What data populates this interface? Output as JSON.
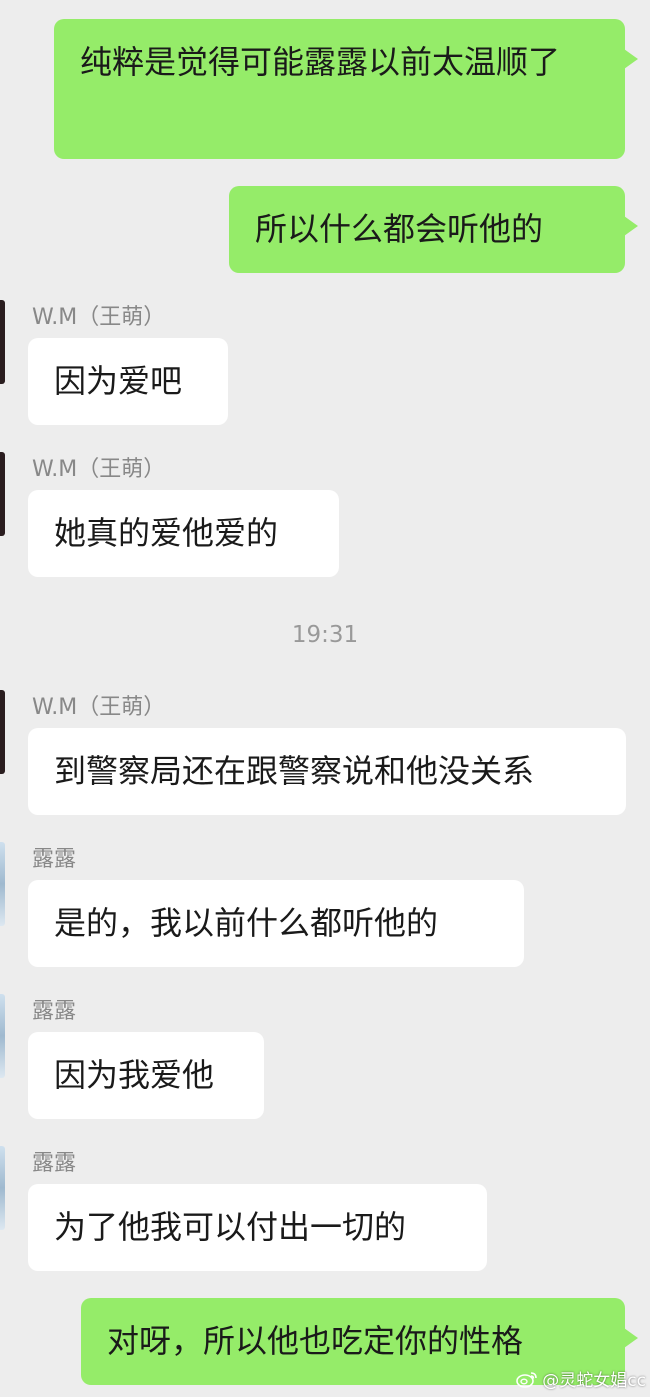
{
  "messages": [
    {
      "sender": "",
      "text": "纯粹是觉得可能露露以前太温顺了"
    },
    {
      "sender": "",
      "text": "所以什么都会听他的"
    },
    {
      "sender": "W.M（王萌）",
      "text": "因为爱吧"
    },
    {
      "sender": "W.M（王萌）",
      "text": "她真的爱他爱的"
    },
    {
      "sender": "W.M（王萌）",
      "text": "到警察局还在跟警察说和他没关系"
    },
    {
      "sender": "露露",
      "text": "是的，我以前什么都听他的"
    },
    {
      "sender": "露露",
      "text": "因为我爱他"
    },
    {
      "sender": "露露",
      "text": "为了他我可以付出一切的"
    },
    {
      "sender": "",
      "text": "对呀，所以他也吃定你的性格"
    }
  ],
  "timestamp": "19:31",
  "watermark": {
    "text": "@灵蛇女娼cc",
    "icon": "weibo-icon"
  },
  "colors": {
    "background": "#ededed",
    "sent_bubble": "#95ec69",
    "received_bubble": "#ffffff",
    "name_text": "#888888",
    "timestamp_text": "#999999"
  }
}
